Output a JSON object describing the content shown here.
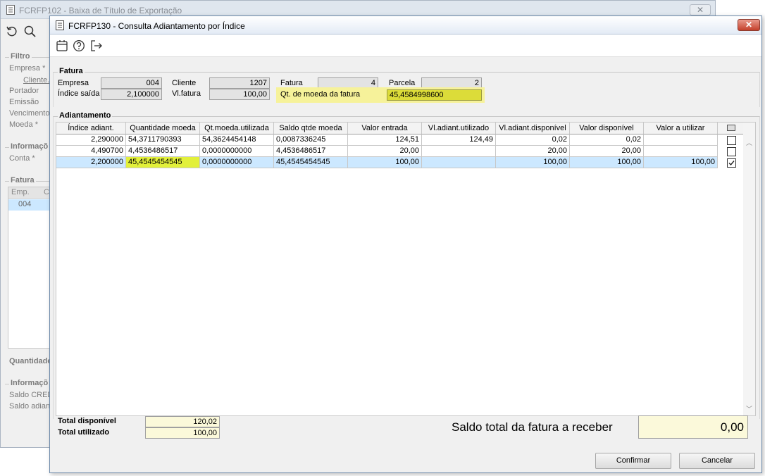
{
  "background_window": {
    "title": "FCRFP102 - Baixa de Título de Exportação",
    "close_glyph": "✕",
    "filter_group": "Filtro",
    "labels": [
      "Empresa *",
      "Cliente..",
      "Portador",
      "Emissão",
      "Vencimento",
      "Moeda *"
    ],
    "info_group": "Informaçõ",
    "conta_label": "Conta *",
    "fatura_group": "Fatura",
    "table_head": [
      "Emp.",
      "Cl"
    ],
    "table_row": [
      "004"
    ],
    "quantidade_label": "Quantidade",
    "info_group2": "Informaçõ",
    "saldo_labels": [
      "Saldo CRED",
      "Saldo adian"
    ]
  },
  "dialog": {
    "title": "FCRFP130 - Consulta Adiantamento por Índice",
    "close_glyph": "✕",
    "toolbar": [
      "calendar-icon",
      "help-icon",
      "exit-icon"
    ],
    "fatura": {
      "group_title": "Fatura",
      "empresa_label": "Empresa",
      "empresa_value": "004",
      "indice_saida_label": "Índice saída",
      "indice_saida_value": "2,100000",
      "cliente_label": "Cliente",
      "cliente_value": "1207",
      "vl_fatura_label": "Vl.fatura",
      "vl_fatura_value": "100,00",
      "fatura_label": "Fatura",
      "fatura_value": "4",
      "parcela_label": "Parcela",
      "parcela_value": "2",
      "qt_moeda_label": "Qt. de moeda da fatura",
      "qt_moeda_value": "45,4584998600",
      "highlight_color": "#f6f29a"
    },
    "adiantamento": {
      "group_title": "Adiantamento",
      "columns": [
        "Índice adiant.",
        "Quantidade moeda",
        "Qt.moeda.utilizada",
        "Saldo qtde moeda",
        "Valor entrada",
        "Vl.adiant.utilizado",
        "Vl.adiant.disponível",
        "Valor disponível",
        "Valor a utilizar"
      ],
      "rows": [
        {
          "cells": [
            "2,290000",
            "54,3711790393",
            "54,3624454148",
            "0,0087336245",
            "124,51",
            "124,49",
            "0,02",
            "0,02",
            ""
          ],
          "checked": false
        },
        {
          "cells": [
            "4,490700",
            "4,4536486517",
            "0,0000000000",
            "4,4536486517",
            "20,00",
            "",
            "20,00",
            "20,00",
            ""
          ],
          "checked": false
        },
        {
          "cells": [
            "2,200000",
            "45,4545454545",
            "0,0000000000",
            "45,4545454545",
            "100,00",
            "",
            "100,00",
            "100,00",
            "100,00"
          ],
          "checked": true
        }
      ],
      "selected_row_color": "#cce8ff",
      "highlight_cell_color": "#e2f03a"
    },
    "totals": {
      "total_disponivel_label": "Total disponível",
      "total_disponivel_value": "120,02",
      "total_utilizado_label": "Total utilizado",
      "total_utilizado_value": "100,00",
      "saldo_label": "Saldo total da fatura a receber",
      "saldo_value": "0,00"
    },
    "buttons": {
      "confirmar": "Confirmar",
      "cancelar": "Cancelar"
    }
  }
}
